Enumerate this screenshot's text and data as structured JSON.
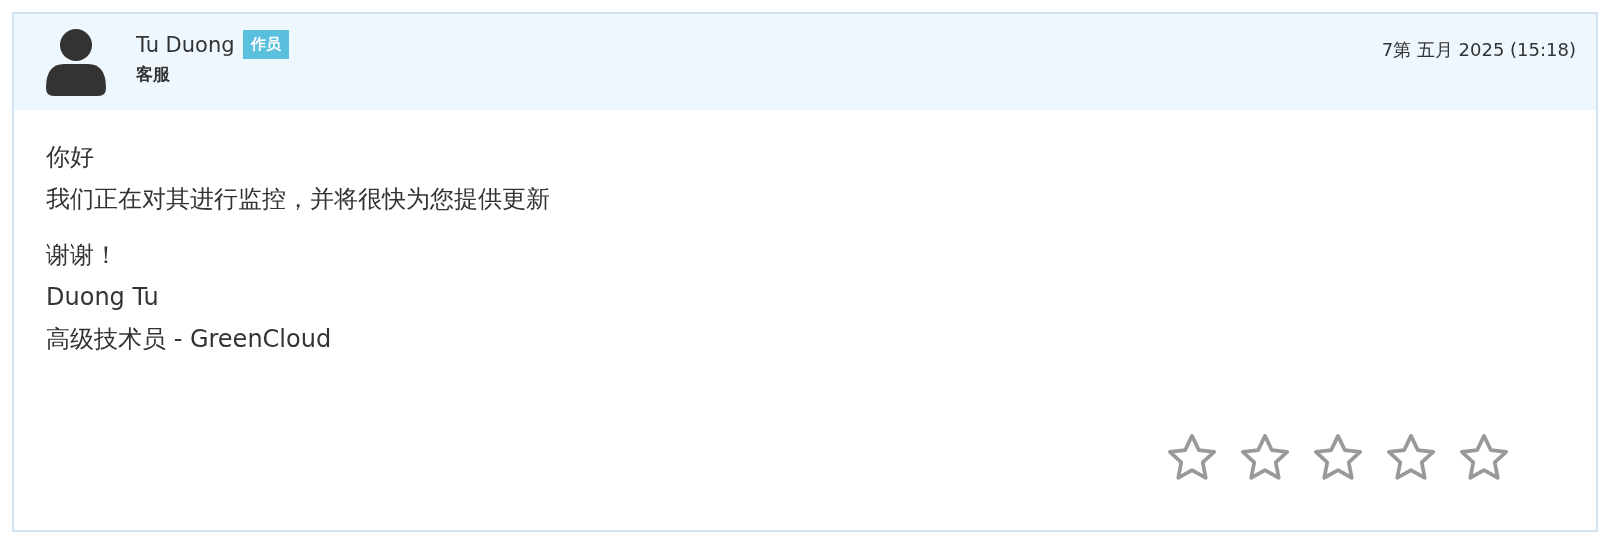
{
  "reply": {
    "author": "Tu Duong",
    "badge": "作员",
    "role": "客服",
    "date": "7第 五月 2025 (15:18)",
    "paragraphs": [
      [
        "你好",
        "我们正在对其进行监控，并将很快为您提供更新"
      ],
      [
        "谢谢！",
        "Duong Tu",
        "高级技术员 - GreenCloud"
      ]
    ],
    "rating": {
      "stars": 0
    }
  }
}
